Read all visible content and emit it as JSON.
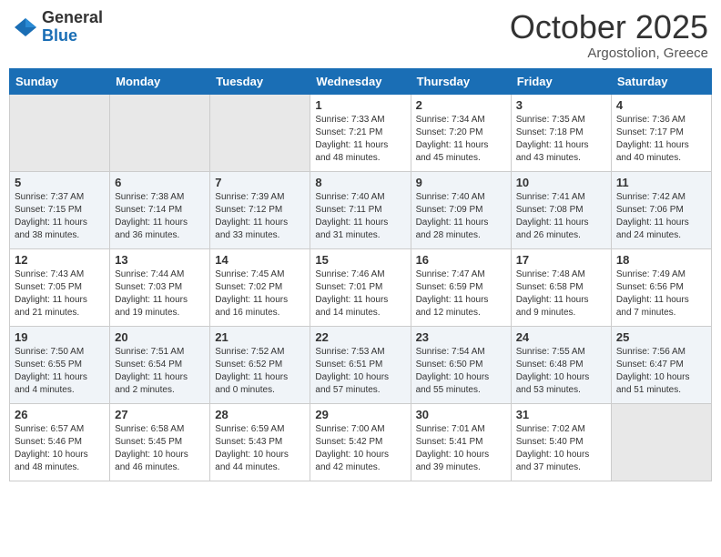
{
  "logo": {
    "general": "General",
    "blue": "Blue"
  },
  "header": {
    "month": "October 2025",
    "location": "Argostolion, Greece"
  },
  "weekdays": [
    "Sunday",
    "Monday",
    "Tuesday",
    "Wednesday",
    "Thursday",
    "Friday",
    "Saturday"
  ],
  "weeks": [
    [
      {
        "day": "",
        "info": ""
      },
      {
        "day": "",
        "info": ""
      },
      {
        "day": "",
        "info": ""
      },
      {
        "day": "1",
        "info": "Sunrise: 7:33 AM\nSunset: 7:21 PM\nDaylight: 11 hours\nand 48 minutes."
      },
      {
        "day": "2",
        "info": "Sunrise: 7:34 AM\nSunset: 7:20 PM\nDaylight: 11 hours\nand 45 minutes."
      },
      {
        "day": "3",
        "info": "Sunrise: 7:35 AM\nSunset: 7:18 PM\nDaylight: 11 hours\nand 43 minutes."
      },
      {
        "day": "4",
        "info": "Sunrise: 7:36 AM\nSunset: 7:17 PM\nDaylight: 11 hours\nand 40 minutes."
      }
    ],
    [
      {
        "day": "5",
        "info": "Sunrise: 7:37 AM\nSunset: 7:15 PM\nDaylight: 11 hours\nand 38 minutes."
      },
      {
        "day": "6",
        "info": "Sunrise: 7:38 AM\nSunset: 7:14 PM\nDaylight: 11 hours\nand 36 minutes."
      },
      {
        "day": "7",
        "info": "Sunrise: 7:39 AM\nSunset: 7:12 PM\nDaylight: 11 hours\nand 33 minutes."
      },
      {
        "day": "8",
        "info": "Sunrise: 7:40 AM\nSunset: 7:11 PM\nDaylight: 11 hours\nand 31 minutes."
      },
      {
        "day": "9",
        "info": "Sunrise: 7:40 AM\nSunset: 7:09 PM\nDaylight: 11 hours\nand 28 minutes."
      },
      {
        "day": "10",
        "info": "Sunrise: 7:41 AM\nSunset: 7:08 PM\nDaylight: 11 hours\nand 26 minutes."
      },
      {
        "day": "11",
        "info": "Sunrise: 7:42 AM\nSunset: 7:06 PM\nDaylight: 11 hours\nand 24 minutes."
      }
    ],
    [
      {
        "day": "12",
        "info": "Sunrise: 7:43 AM\nSunset: 7:05 PM\nDaylight: 11 hours\nand 21 minutes."
      },
      {
        "day": "13",
        "info": "Sunrise: 7:44 AM\nSunset: 7:03 PM\nDaylight: 11 hours\nand 19 minutes."
      },
      {
        "day": "14",
        "info": "Sunrise: 7:45 AM\nSunset: 7:02 PM\nDaylight: 11 hours\nand 16 minutes."
      },
      {
        "day": "15",
        "info": "Sunrise: 7:46 AM\nSunset: 7:01 PM\nDaylight: 11 hours\nand 14 minutes."
      },
      {
        "day": "16",
        "info": "Sunrise: 7:47 AM\nSunset: 6:59 PM\nDaylight: 11 hours\nand 12 minutes."
      },
      {
        "day": "17",
        "info": "Sunrise: 7:48 AM\nSunset: 6:58 PM\nDaylight: 11 hours\nand 9 minutes."
      },
      {
        "day": "18",
        "info": "Sunrise: 7:49 AM\nSunset: 6:56 PM\nDaylight: 11 hours\nand 7 minutes."
      }
    ],
    [
      {
        "day": "19",
        "info": "Sunrise: 7:50 AM\nSunset: 6:55 PM\nDaylight: 11 hours\nand 4 minutes."
      },
      {
        "day": "20",
        "info": "Sunrise: 7:51 AM\nSunset: 6:54 PM\nDaylight: 11 hours\nand 2 minutes."
      },
      {
        "day": "21",
        "info": "Sunrise: 7:52 AM\nSunset: 6:52 PM\nDaylight: 11 hours\nand 0 minutes."
      },
      {
        "day": "22",
        "info": "Sunrise: 7:53 AM\nSunset: 6:51 PM\nDaylight: 10 hours\nand 57 minutes."
      },
      {
        "day": "23",
        "info": "Sunrise: 7:54 AM\nSunset: 6:50 PM\nDaylight: 10 hours\nand 55 minutes."
      },
      {
        "day": "24",
        "info": "Sunrise: 7:55 AM\nSunset: 6:48 PM\nDaylight: 10 hours\nand 53 minutes."
      },
      {
        "day": "25",
        "info": "Sunrise: 7:56 AM\nSunset: 6:47 PM\nDaylight: 10 hours\nand 51 minutes."
      }
    ],
    [
      {
        "day": "26",
        "info": "Sunrise: 6:57 AM\nSunset: 5:46 PM\nDaylight: 10 hours\nand 48 minutes."
      },
      {
        "day": "27",
        "info": "Sunrise: 6:58 AM\nSunset: 5:45 PM\nDaylight: 10 hours\nand 46 minutes."
      },
      {
        "day": "28",
        "info": "Sunrise: 6:59 AM\nSunset: 5:43 PM\nDaylight: 10 hours\nand 44 minutes."
      },
      {
        "day": "29",
        "info": "Sunrise: 7:00 AM\nSunset: 5:42 PM\nDaylight: 10 hours\nand 42 minutes."
      },
      {
        "day": "30",
        "info": "Sunrise: 7:01 AM\nSunset: 5:41 PM\nDaylight: 10 hours\nand 39 minutes."
      },
      {
        "day": "31",
        "info": "Sunrise: 7:02 AM\nSunset: 5:40 PM\nDaylight: 10 hours\nand 37 minutes."
      },
      {
        "day": "",
        "info": ""
      }
    ]
  ]
}
